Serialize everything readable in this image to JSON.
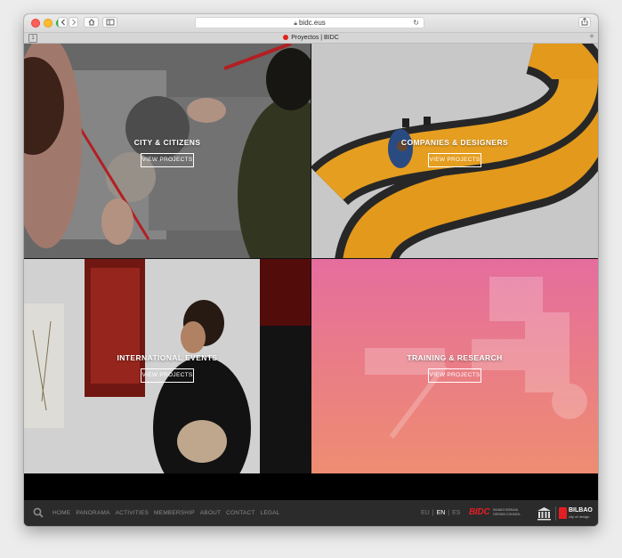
{
  "browser": {
    "url": "bidc.eus",
    "tab_title": "Proyectos | BIDC",
    "back_icon": "chevron-left-icon",
    "forward_icon": "chevron-right-icon"
  },
  "tiles": [
    {
      "title": "CITY & CITIZENS",
      "button": "VIEW PROJECTS"
    },
    {
      "title": "COMPANIES & DESIGNERS",
      "button": "VIEW PROJECTS"
    },
    {
      "title": "INTERNATIONAL EVENTS",
      "button": "VIEW PROJECTS"
    },
    {
      "title": "TRAINING & RESEARCH",
      "button": "VIEW PROJECTS"
    }
  ],
  "footer": {
    "nav": [
      "HOME",
      "PANORAMA",
      "ACTIVITIES",
      "MEMBERSHIP",
      "ABOUT",
      "CONTACT",
      "LEGAL"
    ],
    "languages": [
      "EU",
      "EN",
      "ES"
    ],
    "active_language": "EN",
    "bidc_logo": {
      "word": "BIDC",
      "subtitle": "BILBAO BIZKAIA DESIGN COUNCIL"
    },
    "bilbao_logo": {
      "word": "BILBAO",
      "subtitle": "city of design"
    }
  },
  "colors": {
    "brand_red": "#e31e24",
    "training_gradient_top": "#e56d9e",
    "training_gradient_bottom": "#ee8d72",
    "companies_orange": "#f0a21e"
  }
}
